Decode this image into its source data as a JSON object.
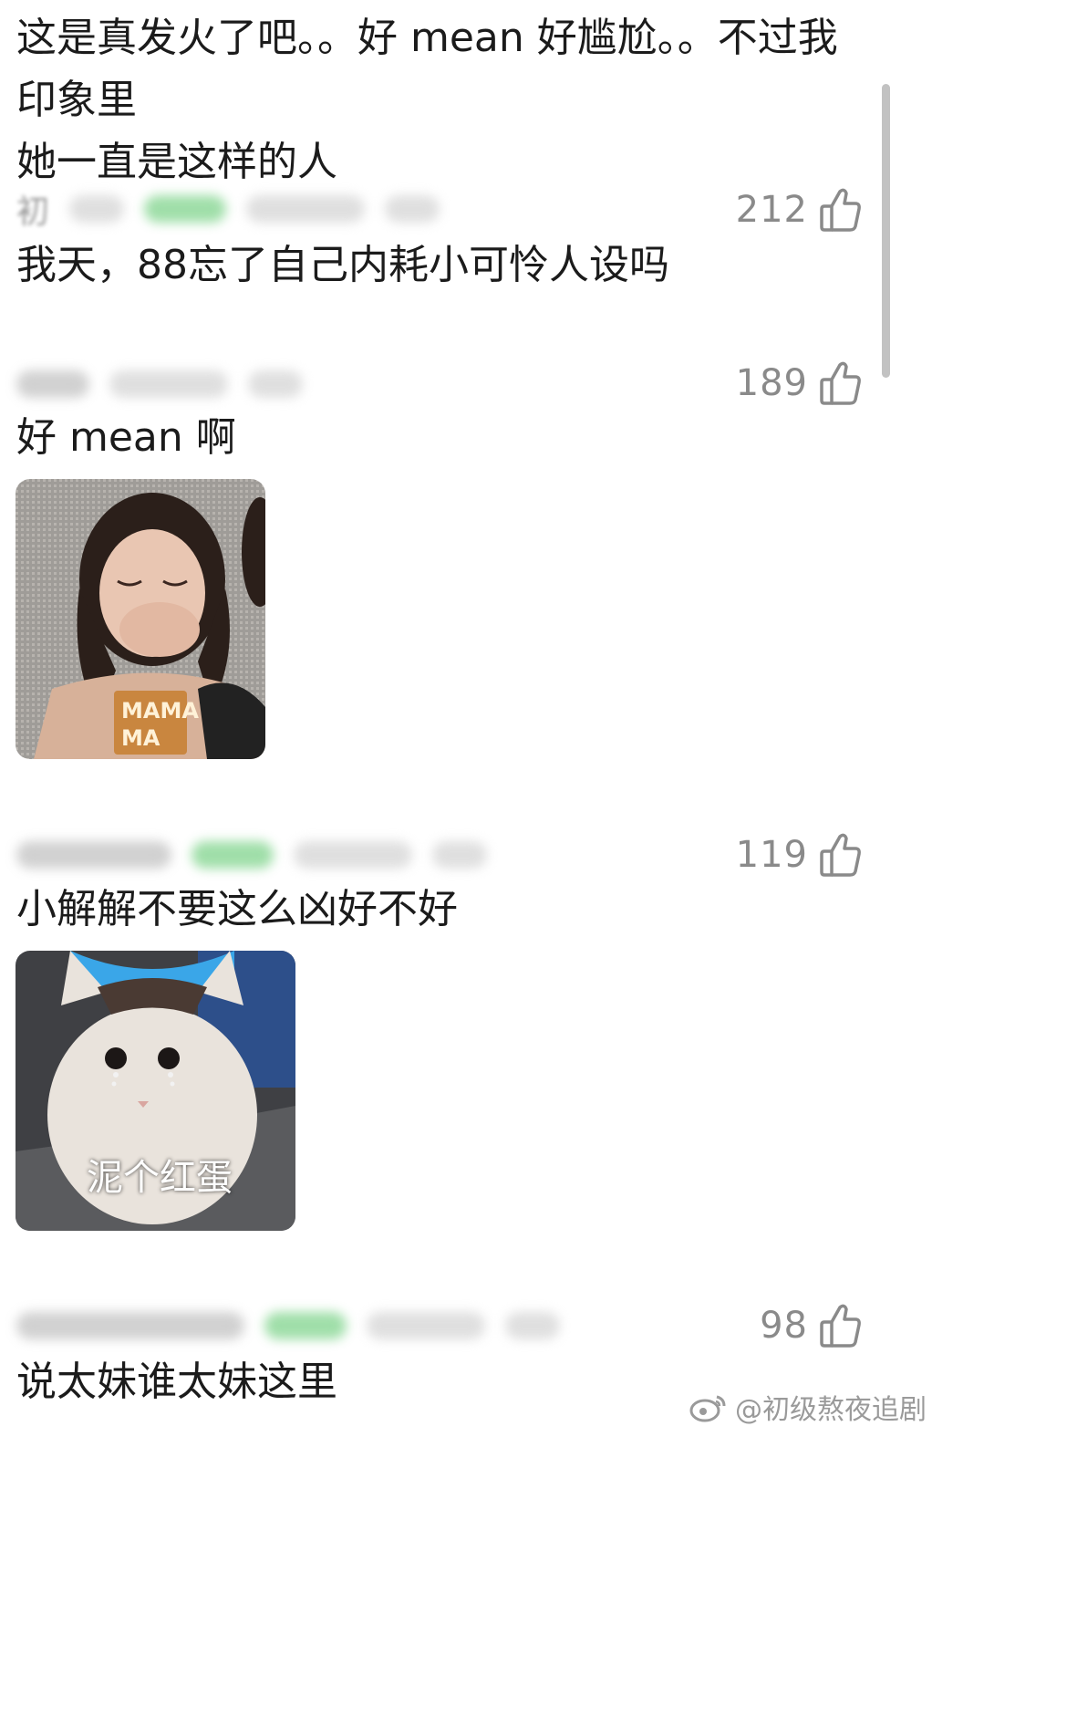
{
  "first_comment": {
    "text": "这是真发火了吧。。好 mean 好尴尬。。不过我印象里\n她一直是这样的人"
  },
  "comments": [
    {
      "username": "初",
      "likes": "212",
      "text": "我天，88忘了自己内耗小可怜人设吗"
    },
    {
      "username": "",
      "likes": "189",
      "text": "好 mean 啊",
      "sticker": {
        "caption": "",
        "overlay": "MAMA"
      }
    },
    {
      "username": "",
      "likes": "119",
      "text": "小解解不要这么凶好不好",
      "sticker": {
        "caption": "泥个红蛋"
      }
    },
    {
      "username": "",
      "likes": "98",
      "text": "说太妹谁太妹这里"
    }
  ],
  "watermark": {
    "text": "@初级熬夜追剧"
  },
  "icons": {
    "like": "thumbs-up-icon",
    "weibo": "weibo-icon"
  },
  "colors": {
    "text": "#1b1b1b",
    "muted": "#8a8a8a",
    "badge_green": "#8fd99a",
    "scrollbar": "#c2c2c2"
  }
}
